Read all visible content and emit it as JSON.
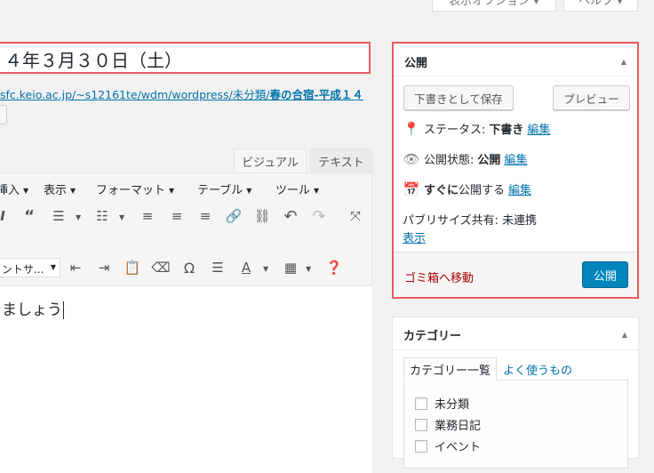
{
  "top": {
    "screen_options": "表示オプション ▾",
    "help": "ヘルプ ▾"
  },
  "editor": {
    "title_value": "４年３月３０日（土）",
    "permalink_prefix": "sfc.keio.ac.jp/~s12161te/wdm/wordpress/未分類/",
    "permalink_slug": "春の合宿-平成１４",
    "tab_visual": "ビジュアル",
    "tab_text": "テキスト",
    "menu": [
      "挿入",
      "表示",
      "フォーマット",
      "テーブル",
      "ツール"
    ],
    "font_select": "ントサ...",
    "content": "ましょう"
  },
  "publish": {
    "title": "公開",
    "save_draft": "下書きとして保存",
    "preview": "プレビュー",
    "status_label": "ステータス:",
    "status_value": "下書き",
    "visibility_label": "公開状態:",
    "visibility_value": "公開",
    "schedule_strong": "すぐに",
    "schedule_text": "公開する",
    "edit": "編集",
    "publicize_label": "パブリサイズ共有: 未連携",
    "publicize_show": "表示",
    "trash": "ゴミ箱へ移動",
    "publish_button": "公開"
  },
  "category": {
    "title": "カテゴリー",
    "tab_all": "カテゴリー一覧",
    "tab_popular": "よく使うもの",
    "items": [
      "未分類",
      "業務日記",
      "イベント"
    ]
  },
  "colors": {
    "accent": "#0085ba",
    "link": "#0073aa",
    "highlight": "#e65c5c",
    "danger": "#aa0000"
  }
}
